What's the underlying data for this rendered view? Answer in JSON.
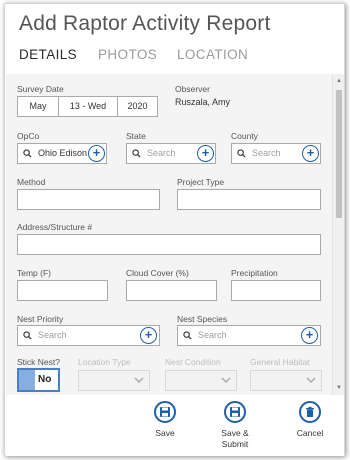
{
  "title": "Add Raptor Activity Report",
  "tabs": [
    {
      "label": "DETAILS",
      "active": true
    },
    {
      "label": "PHOTOS",
      "active": false
    },
    {
      "label": "LOCATION",
      "active": false
    }
  ],
  "form": {
    "survey_date": {
      "label": "Survey Date",
      "month": "May",
      "day": "13 - Wed",
      "year": "2020"
    },
    "observer": {
      "label": "Observer",
      "value": "Ruszala, Amy"
    },
    "opco": {
      "label": "OpCo",
      "value": "Ohio Edison"
    },
    "state": {
      "label": "State",
      "placeholder": "Search"
    },
    "county": {
      "label": "County",
      "placeholder": "Search"
    },
    "method": {
      "label": "Method",
      "value": ""
    },
    "project_type": {
      "label": "Project Type",
      "value": ""
    },
    "address": {
      "label": "Address/Structure #",
      "value": ""
    },
    "temp": {
      "label": "Temp (F)",
      "value": ""
    },
    "cloud_cover": {
      "label": "Cloud Cover (%)",
      "value": ""
    },
    "precipitation": {
      "label": "Precipitation",
      "value": ""
    },
    "nest_priority": {
      "label": "Nest Priority",
      "placeholder": "Search"
    },
    "nest_species": {
      "label": "Nest Species",
      "placeholder": "Search"
    },
    "stick_nest": {
      "label": "Stick Nest?",
      "value": "No"
    },
    "location_type": {
      "label": "Location Type"
    },
    "nest_condition": {
      "label": "Nest Condition"
    },
    "general_habitat": {
      "label": "General Habitat"
    }
  },
  "actions": {
    "save": "Save",
    "save_submit": "Save &\nSubmit",
    "cancel": "Cancel"
  },
  "colors": {
    "accent": "#1f5fa5",
    "toggle_fill": "#86aede",
    "panel_bg": "#f4f4f4"
  },
  "icons": {
    "search": "search-icon",
    "add": "plus-circle-icon",
    "dropdown": "chevron-down-icon",
    "save": "floppy-disk-icon",
    "cancel": "trash-icon"
  }
}
